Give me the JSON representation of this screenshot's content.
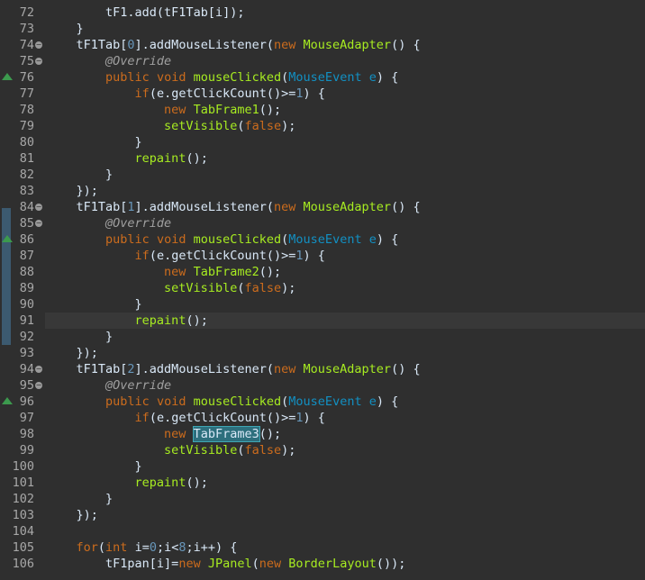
{
  "lines": [
    {
      "n": "72",
      "fold": false,
      "override": false,
      "tokens": [
        {
          "t": "        "
        },
        {
          "t": "tF1.add(tF1Tab[i]);"
        }
      ]
    },
    {
      "n": "73",
      "fold": false,
      "override": false,
      "tokens": [
        {
          "t": "    }"
        }
      ]
    },
    {
      "n": "74",
      "fold": true,
      "override": false,
      "tokens": [
        {
          "t": "    tF1Tab["
        },
        {
          "t": "0",
          "c": "num"
        },
        {
          "t": "].addMouseListener("
        },
        {
          "t": "new",
          "c": "kw"
        },
        {
          "t": " "
        },
        {
          "t": "MouseAdapter",
          "c": "method"
        },
        {
          "t": "() {"
        }
      ]
    },
    {
      "n": "75",
      "fold": true,
      "override": false,
      "tokens": [
        {
          "t": "        "
        },
        {
          "t": "@Override",
          "c": "ann"
        }
      ]
    },
    {
      "n": "76",
      "fold": false,
      "override": true,
      "tokens": [
        {
          "t": "        "
        },
        {
          "t": "public",
          "c": "kw"
        },
        {
          "t": " "
        },
        {
          "t": "void",
          "c": "kw"
        },
        {
          "t": " "
        },
        {
          "t": "mouseClicked",
          "c": "method"
        },
        {
          "t": "("
        },
        {
          "t": "MouseEvent",
          "c": "type"
        },
        {
          "t": " "
        },
        {
          "t": "e",
          "c": "type"
        },
        {
          "t": ") {"
        }
      ]
    },
    {
      "n": "77",
      "fold": false,
      "override": false,
      "tokens": [
        {
          "t": "            "
        },
        {
          "t": "if",
          "c": "kw"
        },
        {
          "t": "(e.getClickCount()>="
        },
        {
          "t": "1",
          "c": "num"
        },
        {
          "t": ") {"
        }
      ]
    },
    {
      "n": "78",
      "fold": false,
      "override": false,
      "tokens": [
        {
          "t": "                "
        },
        {
          "t": "new",
          "c": "kw"
        },
        {
          "t": " "
        },
        {
          "t": "TabFrame1",
          "c": "method"
        },
        {
          "t": "();"
        }
      ]
    },
    {
      "n": "79",
      "fold": false,
      "override": false,
      "tokens": [
        {
          "t": "                "
        },
        {
          "t": "setVisible",
          "c": "method"
        },
        {
          "t": "("
        },
        {
          "t": "false",
          "c": "kw"
        },
        {
          "t": ");"
        }
      ]
    },
    {
      "n": "80",
      "fold": false,
      "override": false,
      "tokens": [
        {
          "t": "            }"
        }
      ]
    },
    {
      "n": "81",
      "fold": false,
      "override": false,
      "tokens": [
        {
          "t": "            "
        },
        {
          "t": "repaint",
          "c": "method"
        },
        {
          "t": "();"
        }
      ]
    },
    {
      "n": "82",
      "fold": false,
      "override": false,
      "tokens": [
        {
          "t": "        }"
        }
      ]
    },
    {
      "n": "83",
      "fold": false,
      "override": false,
      "tokens": [
        {
          "t": "    });"
        }
      ]
    },
    {
      "n": "84",
      "fold": true,
      "override": false,
      "tokens": [
        {
          "t": "    tF1Tab["
        },
        {
          "t": "1",
          "c": "num"
        },
        {
          "t": "].addMouseListener("
        },
        {
          "t": "new",
          "c": "kw"
        },
        {
          "t": " "
        },
        {
          "t": "MouseAdapter",
          "c": "method"
        },
        {
          "t": "() {"
        }
      ]
    },
    {
      "n": "85",
      "fold": true,
      "override": false,
      "tokens": [
        {
          "t": "        "
        },
        {
          "t": "@Override",
          "c": "ann"
        }
      ]
    },
    {
      "n": "86",
      "fold": false,
      "override": true,
      "tokens": [
        {
          "t": "        "
        },
        {
          "t": "public",
          "c": "kw"
        },
        {
          "t": " "
        },
        {
          "t": "void",
          "c": "kw"
        },
        {
          "t": " "
        },
        {
          "t": "mouseClicked",
          "c": "method"
        },
        {
          "t": "("
        },
        {
          "t": "MouseEvent",
          "c": "type"
        },
        {
          "t": " "
        },
        {
          "t": "e",
          "c": "type"
        },
        {
          "t": ") {"
        }
      ]
    },
    {
      "n": "87",
      "fold": false,
      "override": false,
      "tokens": [
        {
          "t": "            "
        },
        {
          "t": "if",
          "c": "kw"
        },
        {
          "t": "(e.getClickCount()>="
        },
        {
          "t": "1",
          "c": "num"
        },
        {
          "t": ") {"
        }
      ]
    },
    {
      "n": "88",
      "fold": false,
      "override": false,
      "tokens": [
        {
          "t": "                "
        },
        {
          "t": "new",
          "c": "kw"
        },
        {
          "t": " "
        },
        {
          "t": "TabFrame2",
          "c": "method"
        },
        {
          "t": "();"
        }
      ]
    },
    {
      "n": "89",
      "fold": false,
      "override": false,
      "tokens": [
        {
          "t": "                "
        },
        {
          "t": "setVisible",
          "c": "method"
        },
        {
          "t": "("
        },
        {
          "t": "false",
          "c": "kw"
        },
        {
          "t": ");"
        }
      ]
    },
    {
      "n": "90",
      "fold": false,
      "override": false,
      "tokens": [
        {
          "t": "            }"
        }
      ]
    },
    {
      "n": "91",
      "fold": false,
      "override": false,
      "current": true,
      "tokens": [
        {
          "t": "            "
        },
        {
          "t": "repaint",
          "c": "method"
        },
        {
          "t": "();"
        }
      ]
    },
    {
      "n": "92",
      "fold": false,
      "override": false,
      "tokens": [
        {
          "t": "        }"
        }
      ]
    },
    {
      "n": "93",
      "fold": false,
      "override": false,
      "tokens": [
        {
          "t": "    });"
        }
      ]
    },
    {
      "n": "94",
      "fold": true,
      "override": false,
      "tokens": [
        {
          "t": "    tF1Tab["
        },
        {
          "t": "2",
          "c": "num"
        },
        {
          "t": "].addMouseListener("
        },
        {
          "t": "new",
          "c": "kw"
        },
        {
          "t": " "
        },
        {
          "t": "MouseAdapter",
          "c": "method"
        },
        {
          "t": "() {"
        }
      ]
    },
    {
      "n": "95",
      "fold": true,
      "override": false,
      "tokens": [
        {
          "t": "        "
        },
        {
          "t": "@Override",
          "c": "ann"
        }
      ]
    },
    {
      "n": "96",
      "fold": false,
      "override": true,
      "tokens": [
        {
          "t": "        "
        },
        {
          "t": "public",
          "c": "kw"
        },
        {
          "t": " "
        },
        {
          "t": "void",
          "c": "kw"
        },
        {
          "t": " "
        },
        {
          "t": "mouseClicked",
          "c": "method"
        },
        {
          "t": "("
        },
        {
          "t": "MouseEvent",
          "c": "type"
        },
        {
          "t": " "
        },
        {
          "t": "e",
          "c": "type"
        },
        {
          "t": ") {"
        }
      ]
    },
    {
      "n": "97",
      "fold": false,
      "override": false,
      "tokens": [
        {
          "t": "            "
        },
        {
          "t": "if",
          "c": "kw"
        },
        {
          "t": "(e.getClickCount()>="
        },
        {
          "t": "1",
          "c": "num"
        },
        {
          "t": ") {"
        }
      ]
    },
    {
      "n": "98",
      "fold": false,
      "override": false,
      "tokens": [
        {
          "t": "                "
        },
        {
          "t": "new",
          "c": "kw"
        },
        {
          "t": " "
        },
        {
          "t": "TabFrame3",
          "c": "method",
          "hl": true
        },
        {
          "t": "();"
        }
      ]
    },
    {
      "n": "99",
      "fold": false,
      "override": false,
      "tokens": [
        {
          "t": "                "
        },
        {
          "t": "setVisible",
          "c": "method"
        },
        {
          "t": "("
        },
        {
          "t": "false",
          "c": "kw"
        },
        {
          "t": ");"
        }
      ]
    },
    {
      "n": "100",
      "fold": false,
      "override": false,
      "tokens": [
        {
          "t": "            }"
        }
      ]
    },
    {
      "n": "101",
      "fold": false,
      "override": false,
      "tokens": [
        {
          "t": "            "
        },
        {
          "t": "repaint",
          "c": "method"
        },
        {
          "t": "();"
        }
      ]
    },
    {
      "n": "102",
      "fold": false,
      "override": false,
      "tokens": [
        {
          "t": "        }"
        }
      ]
    },
    {
      "n": "103",
      "fold": false,
      "override": false,
      "tokens": [
        {
          "t": "    });"
        }
      ]
    },
    {
      "n": "104",
      "fold": false,
      "override": false,
      "tokens": []
    },
    {
      "n": "105",
      "fold": false,
      "override": false,
      "tokens": [
        {
          "t": "    "
        },
        {
          "t": "for",
          "c": "kw"
        },
        {
          "t": "("
        },
        {
          "t": "int",
          "c": "kw"
        },
        {
          "t": " i="
        },
        {
          "t": "0",
          "c": "num"
        },
        {
          "t": ";i<"
        },
        {
          "t": "8",
          "c": "num"
        },
        {
          "t": ";i++) {"
        }
      ]
    },
    {
      "n": "106",
      "fold": false,
      "override": false,
      "tokens": [
        {
          "t": "        tF1pan[i]="
        },
        {
          "t": "new",
          "c": "kw"
        },
        {
          "t": " "
        },
        {
          "t": "JPanel",
          "c": "method"
        },
        {
          "t": "("
        },
        {
          "t": "new",
          "c": "kw"
        },
        {
          "t": " "
        },
        {
          "t": "BorderLayout",
          "c": "method"
        },
        {
          "t": "());"
        }
      ]
    }
  ],
  "colors": {
    "background": "#2f2f2f",
    "keyword": "#cc6c1d",
    "method": "#a7ec21",
    "type": "#1290c3",
    "annotation": "#a0a0a0",
    "number": "#6897bb",
    "override_marker": "#3c9a4e",
    "change_bar": "#3c5a70"
  }
}
